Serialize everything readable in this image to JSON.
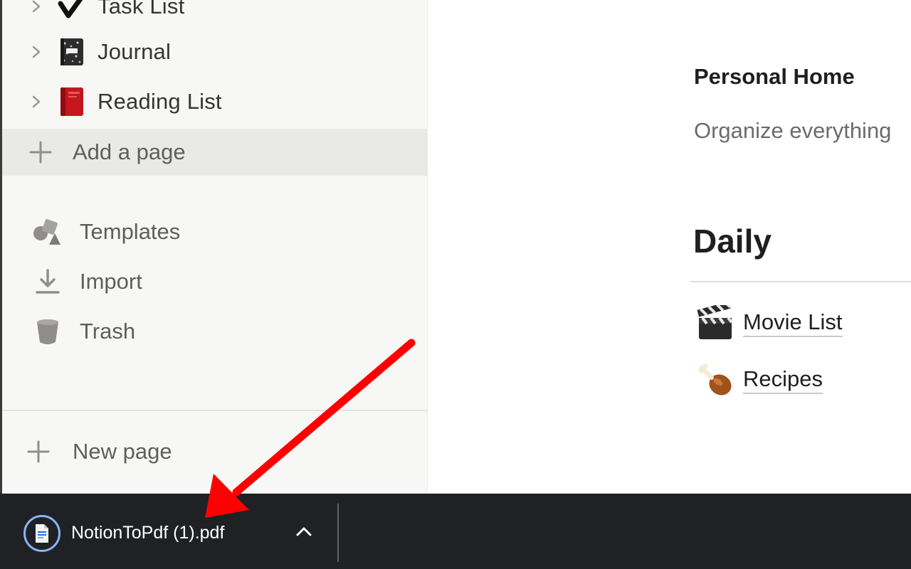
{
  "sidebar": {
    "pages": [
      {
        "label": "Task List",
        "icon": "checkmark-icon"
      },
      {
        "label": "Journal",
        "icon": "notebook-icon"
      },
      {
        "label": "Reading List",
        "icon": "red-book-icon"
      }
    ],
    "add_page": "Add a page",
    "tools": [
      {
        "label": "Templates",
        "icon": "shapes-icon"
      },
      {
        "label": "Import",
        "icon": "download-icon"
      },
      {
        "label": "Trash",
        "icon": "trash-icon"
      }
    ],
    "new_page": "New page"
  },
  "main": {
    "title": "Personal Home",
    "subtitle": "Organize everything",
    "section": "Daily",
    "links": [
      {
        "label": "Movie List",
        "icon": "clapper-board-icon"
      },
      {
        "label": "Recipes",
        "icon": "poultry-leg-icon"
      }
    ]
  },
  "downloads": {
    "file_name": "NotionToPdf (1).pdf",
    "file_icon": "pdf-file-icon",
    "accent": "#8ab4f8"
  },
  "colors": {
    "sidebar_bg": "#f7f7f5",
    "hover_bg": "#e9e9e7",
    "download_bar_bg": "#202124",
    "arrow": "#ff0000"
  }
}
